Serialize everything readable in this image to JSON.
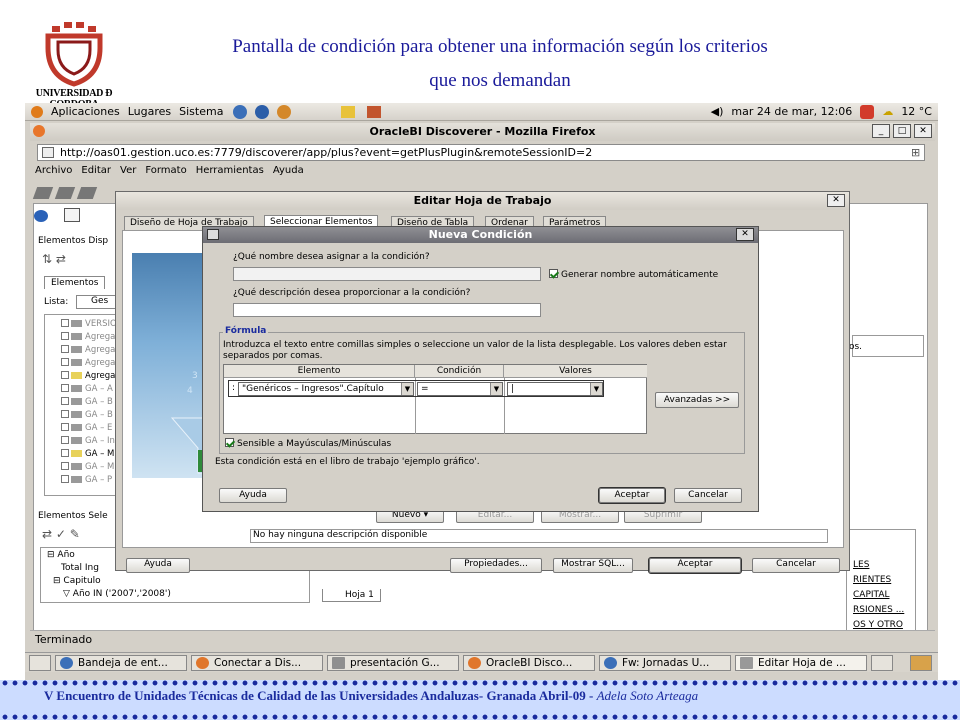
{
  "slide": {
    "title_line1": "Pantalla de condición para obtener una información según los criterios",
    "title_line2": "que nos demandan",
    "logo_text": "UNIVERSIDAD Ð CORDOBA",
    "footer_main": "V Encuentro de Unidades Técnicas de Calidad de las Universidades Andaluzas- Granada Abril-09 - ",
    "footer_author": "Adela Soto Arteaga"
  },
  "gnome_panel": {
    "menus": [
      "Aplicaciones",
      "Lugares",
      "Sistema"
    ],
    "clock": "mar 24 de mar, 12:06",
    "temp": "12 °C"
  },
  "browser": {
    "window_title": "OracleBI Discoverer - Mozilla Firefox",
    "url": "http://oas01.gestion.uco.es:7779/discoverer/app/plus?event=getPlusPlugin&remoteSessionID=2",
    "menu": [
      "Archivo",
      "Editar",
      "Ver",
      "Formato",
      "Herramientas",
      "Ayuda"
    ],
    "status": "Terminado"
  },
  "discoverer": {
    "elementos_disp": "Elementos Disp",
    "tab_elementos": "Elementos",
    "lista_label": "Lista:",
    "lista_value": "Ges",
    "tree": [
      "VERSIO",
      "Agrega",
      "Agrega",
      "Agrega",
      "Agrega",
      "GA – A",
      "GA – B",
      "GA – B",
      "GA – E",
      "GA – In",
      "GA – M",
      "GA – M",
      "GA – P"
    ],
    "elementos_sel": "Elementos Sele",
    "selected": [
      "Año",
      "Total Ing",
      "Capitulo",
      "Año IN ('2007','2008')"
    ],
    "sheet_tab": "Hoja 1",
    "right_labels": [
      "LES",
      "RIENTES",
      "CAPITAL",
      "RSIONES ...",
      "OS Y OTRO"
    ],
    "ionados": "ionados."
  },
  "editar_dialog": {
    "title": "Editar Hoja de Trabajo",
    "tabs": [
      "Diseño de Hoja de Trabajo",
      "Seleccionar Elementos",
      "Diseño de Tabla",
      "Ordenar",
      "Parámetros"
    ],
    "buttons": {
      "nuevo": "Nuevo",
      "editar": "Editar...",
      "mostrar": "Mostrar...",
      "suprimir": "Suprimir"
    },
    "no_desc": "No hay ninguna descripción disponible",
    "footer_buttons": {
      "ayuda": "Ayuda",
      "propiedades": "Propiedades...",
      "mostrar_sql": "Mostrar SQL...",
      "aceptar": "Aceptar",
      "cancelar": "Cancelar"
    }
  },
  "condicion_dialog": {
    "title": "Nueva Condición",
    "q_nombre": "¿Qué nombre desea asignar a la condición?",
    "nombre_value": "",
    "gen_nombre": "Generar nombre automáticamente",
    "q_descripcion": "¿Qué descripción desea proporcionar a la condición?",
    "descripcion_value": "",
    "formula_legend": "Fórmula",
    "formula_help": "Introduzca el texto entre comillas simples o seleccione un valor de la lista desplegable. Los valores deben estar separados por comas.",
    "headers": [
      "Elemento",
      "Condición",
      "Valores"
    ],
    "row": {
      "elemento": "\"Genéricos – Ingresos\".Capítulo",
      "condicion": "=",
      "valores": ""
    },
    "avanzadas": "Avanzadas >>",
    "sensible": "Sensible a Mayúsculas/Minúsculas",
    "libro_msg": "Esta condición está en el libro de trabajo 'ejemplo gráfico'.",
    "ayuda": "Ayuda",
    "aceptar": "Aceptar",
    "cancelar": "Cancelar"
  },
  "taskbar": [
    "Bandeja de ent...",
    "Conectar a Dis...",
    "presentación G...",
    "OracleBI Disco...",
    "Fw: Jornadas U...",
    "Editar Hoja de ..."
  ]
}
